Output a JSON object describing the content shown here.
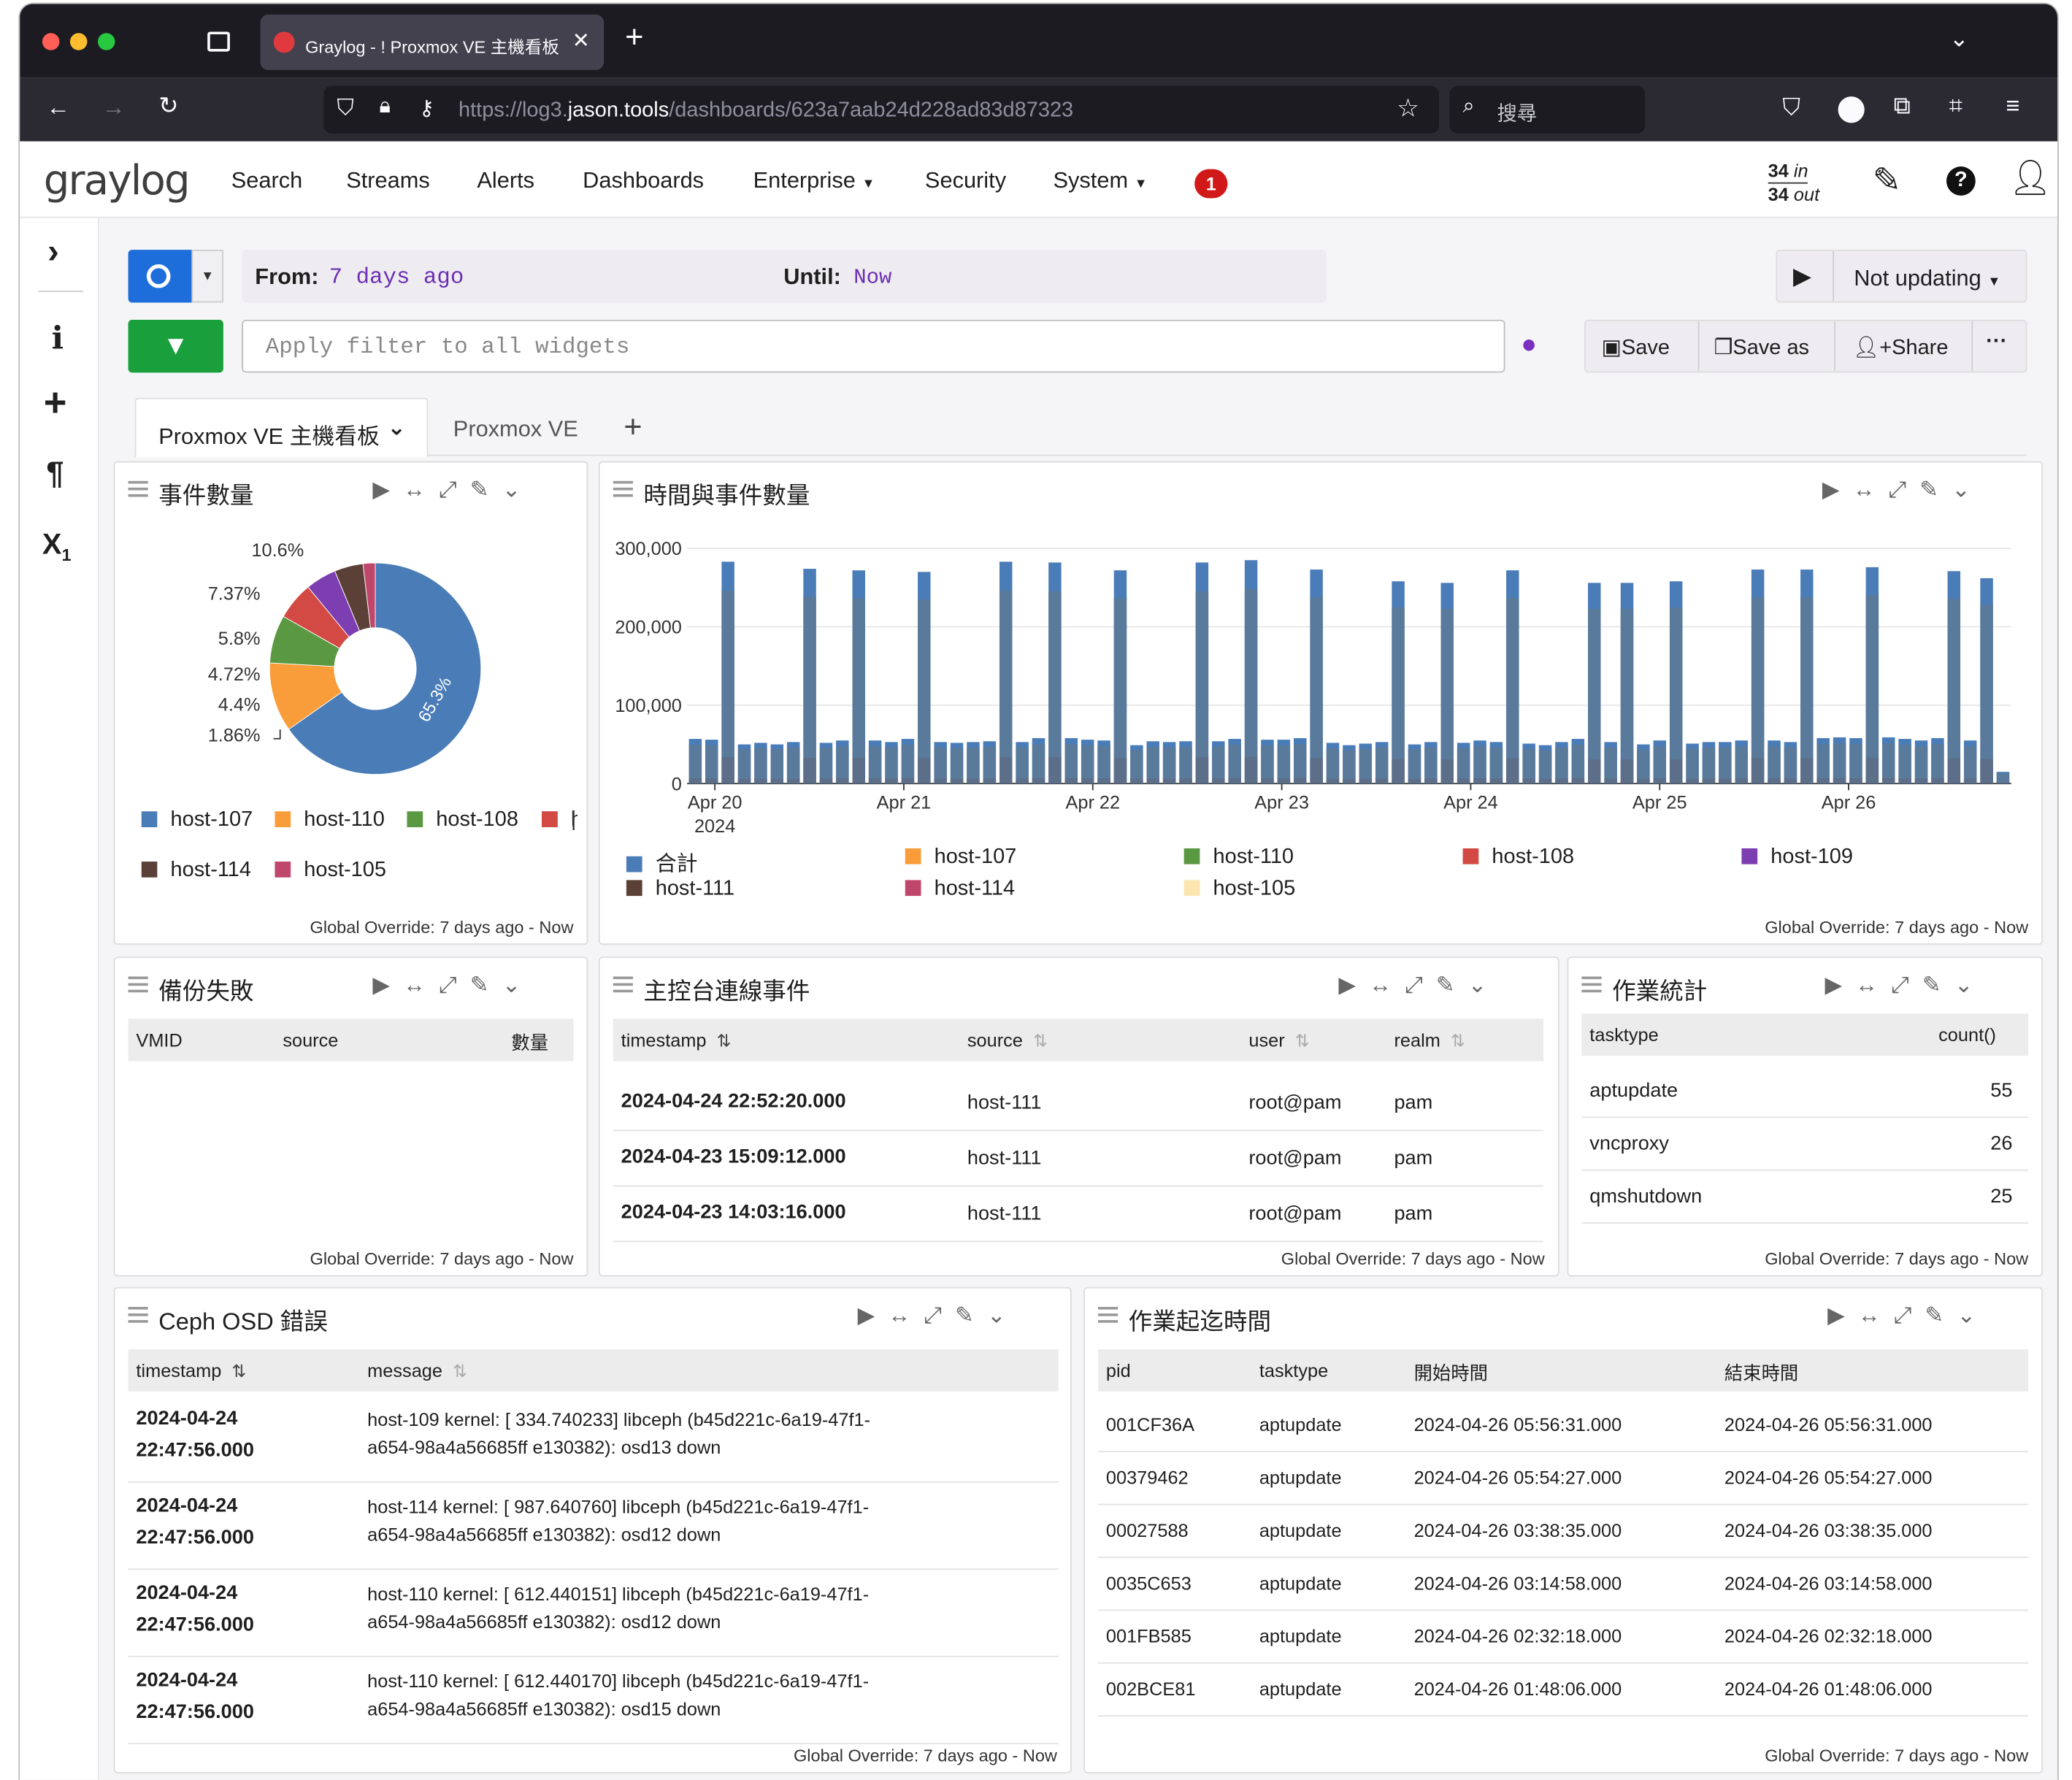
{
  "browser": {
    "tab_title": "Graylog - ! Proxmox VE 主機看板",
    "url_prefix": "https://log3.",
    "url_domain": "jason.tools",
    "url_path": "/dashboards/623a7aab24d228ad83d87323",
    "search_placeholder": "搜尋"
  },
  "nav": {
    "logo": "graylog",
    "items": [
      "Search",
      "Streams",
      "Alerts",
      "Dashboards",
      "Enterprise",
      "Security",
      "System"
    ],
    "notification_count": "1",
    "throughput_in": "34",
    "throughput_in_label": "in",
    "throughput_out": "34",
    "throughput_out_label": "out"
  },
  "query": {
    "from_label": "From:",
    "from_value": "7 days ago",
    "until_label": "Until:",
    "until_value": "Now",
    "update_label": "Not updating",
    "filter_placeholder": "Apply filter to all widgets",
    "save_label": "Save",
    "save_as_label": "Save as",
    "share_label": "Share"
  },
  "tabs": [
    "Proxmox VE 主機看板",
    "Proxmox VE"
  ],
  "footer_text": "Global Override: 7 days ago - Now",
  "widgets": {
    "pie": {
      "title": "事件數量"
    },
    "bar": {
      "title": "時間與事件數量"
    },
    "backup": {
      "title": "備份失敗",
      "columns": [
        "VMID",
        "source",
        "數量"
      ]
    },
    "console": {
      "title": "主控台連線事件",
      "columns": [
        "timestamp",
        "source",
        "user",
        "realm"
      ],
      "rows": [
        [
          "2024-04-24 22:52:20.000",
          "host-111",
          "root@pam",
          "pam"
        ],
        [
          "2024-04-23 15:09:12.000",
          "host-111",
          "root@pam",
          "pam"
        ],
        [
          "2024-04-23 14:03:16.000",
          "host-111",
          "root@pam",
          "pam"
        ]
      ]
    },
    "tasks": {
      "title": "作業統計",
      "columns": [
        "tasktype",
        "count()"
      ],
      "rows": [
        [
          "aptupdate",
          "55"
        ],
        [
          "vncproxy",
          "26"
        ],
        [
          "qmshutdown",
          "25"
        ]
      ]
    },
    "ceph": {
      "title": "Ceph OSD 錯誤",
      "columns": [
        "timestamp",
        "message"
      ],
      "rows": [
        [
          "2024-04-24",
          "22:47:56.000",
          "host-109 kernel: [ 334.740233] libceph (b45d221c-6a19-47f1-",
          "a654-98a4a56685ff e130382): osd13 down"
        ],
        [
          "2024-04-24",
          "22:47:56.000",
          "host-114 kernel: [ 987.640760] libceph (b45d221c-6a19-47f1-",
          "a654-98a4a56685ff e130382): osd12 down"
        ],
        [
          "2024-04-24",
          "22:47:56.000",
          "host-110 kernel: [ 612.440151] libceph (b45d221c-6a19-47f1-",
          "a654-98a4a56685ff e130382): osd12 down"
        ],
        [
          "2024-04-24",
          "22:47:56.000",
          "host-110 kernel: [ 612.440170] libceph (b45d221c-6a19-47f1-",
          "a654-98a4a56685ff e130382): osd15 down"
        ]
      ]
    },
    "times": {
      "title": "作業起迄時間",
      "columns": [
        "pid",
        "tasktype",
        "開始時間",
        "結束時間"
      ],
      "rows": [
        [
          "001CF36A",
          "aptupdate",
          "2024-04-26 05:56:31.000",
          "2024-04-26 05:56:31.000"
        ],
        [
          "00379462",
          "aptupdate",
          "2024-04-26 05:54:27.000",
          "2024-04-26 05:54:27.000"
        ],
        [
          "00027588",
          "aptupdate",
          "2024-04-26 03:38:35.000",
          "2024-04-26 03:38:35.000"
        ],
        [
          "0035C653",
          "aptupdate",
          "2024-04-26 03:14:58.000",
          "2024-04-26 03:14:58.000"
        ],
        [
          "001FB585",
          "aptupdate",
          "2024-04-26 02:32:18.000",
          "2024-04-26 02:32:18.000"
        ],
        [
          "002BCE81",
          "aptupdate",
          "2024-04-26 01:48:06.000",
          "2024-04-26 01:48:06.000"
        ]
      ]
    }
  },
  "chart_data": [
    {
      "type": "pie",
      "title": "事件數量",
      "labels": [
        "host-107",
        "host-110",
        "host-108",
        "host-109",
        "host-111",
        "host-114",
        "host-105"
      ],
      "values": [
        65.3,
        10.6,
        7.37,
        5.8,
        4.72,
        4.4,
        1.86
      ],
      "value_labels": [
        "65.3%",
        "10.6%",
        "7.37%",
        "5.8%",
        "4.72%",
        "4.4%",
        "1.86%"
      ],
      "colors": [
        "#4a7cb8",
        "#f99d3a",
        "#5b9842",
        "#d24a43",
        "#7c3eb1",
        "#5b4038",
        "#c0476c"
      ],
      "legend_visible": [
        "host-107",
        "host-110",
        "host-108",
        "host-114",
        "host-105"
      ],
      "hole": true
    },
    {
      "type": "bar",
      "title": "時間與事件數量",
      "ylim": [
        0,
        300000
      ],
      "yticks": [
        "300,000",
        "200,000",
        "100,000",
        "0"
      ],
      "xticks": [
        "Apr 20\n2024",
        "Apr 21",
        "Apr 22",
        "Apr 23",
        "Apr 24",
        "Apr 25",
        "Apr 26"
      ],
      "series_names": [
        "合計",
        "host-107",
        "host-110",
        "host-108",
        "host-109",
        "host-111",
        "host-114",
        "host-105"
      ],
      "series_colors": [
        "#4a7cb8",
        "#f99d3a",
        "#5b9842",
        "#d24a43",
        "#7c3eb1",
        "#5b4038",
        "#c0476c",
        "#fce5b0"
      ],
      "values": [
        57000,
        56000,
        283000,
        50000,
        52000,
        50000,
        53000,
        274000,
        52000,
        55000,
        272000,
        55000,
        53000,
        57000,
        270000,
        53000,
        52000,
        53000,
        54000,
        283000,
        53000,
        58000,
        282000,
        58000,
        56000,
        55000,
        272000,
        49000,
        54000,
        53000,
        54000,
        282000,
        54000,
        57000,
        285000,
        56000,
        56000,
        58000,
        273000,
        52000,
        49000,
        51000,
        53000,
        258000,
        50000,
        53000,
        256000,
        52000,
        55000,
        53000,
        272000,
        51000,
        49000,
        53000,
        57000,
        256000,
        53000,
        256000,
        50000,
        55000,
        258000,
        51000,
        53000,
        53000,
        55000,
        273000,
        55000,
        53000,
        273000,
        58000,
        59000,
        58000,
        276000,
        59000,
        57000,
        55000,
        58000,
        271000,
        55000,
        262000,
        15000
      ]
    }
  ]
}
